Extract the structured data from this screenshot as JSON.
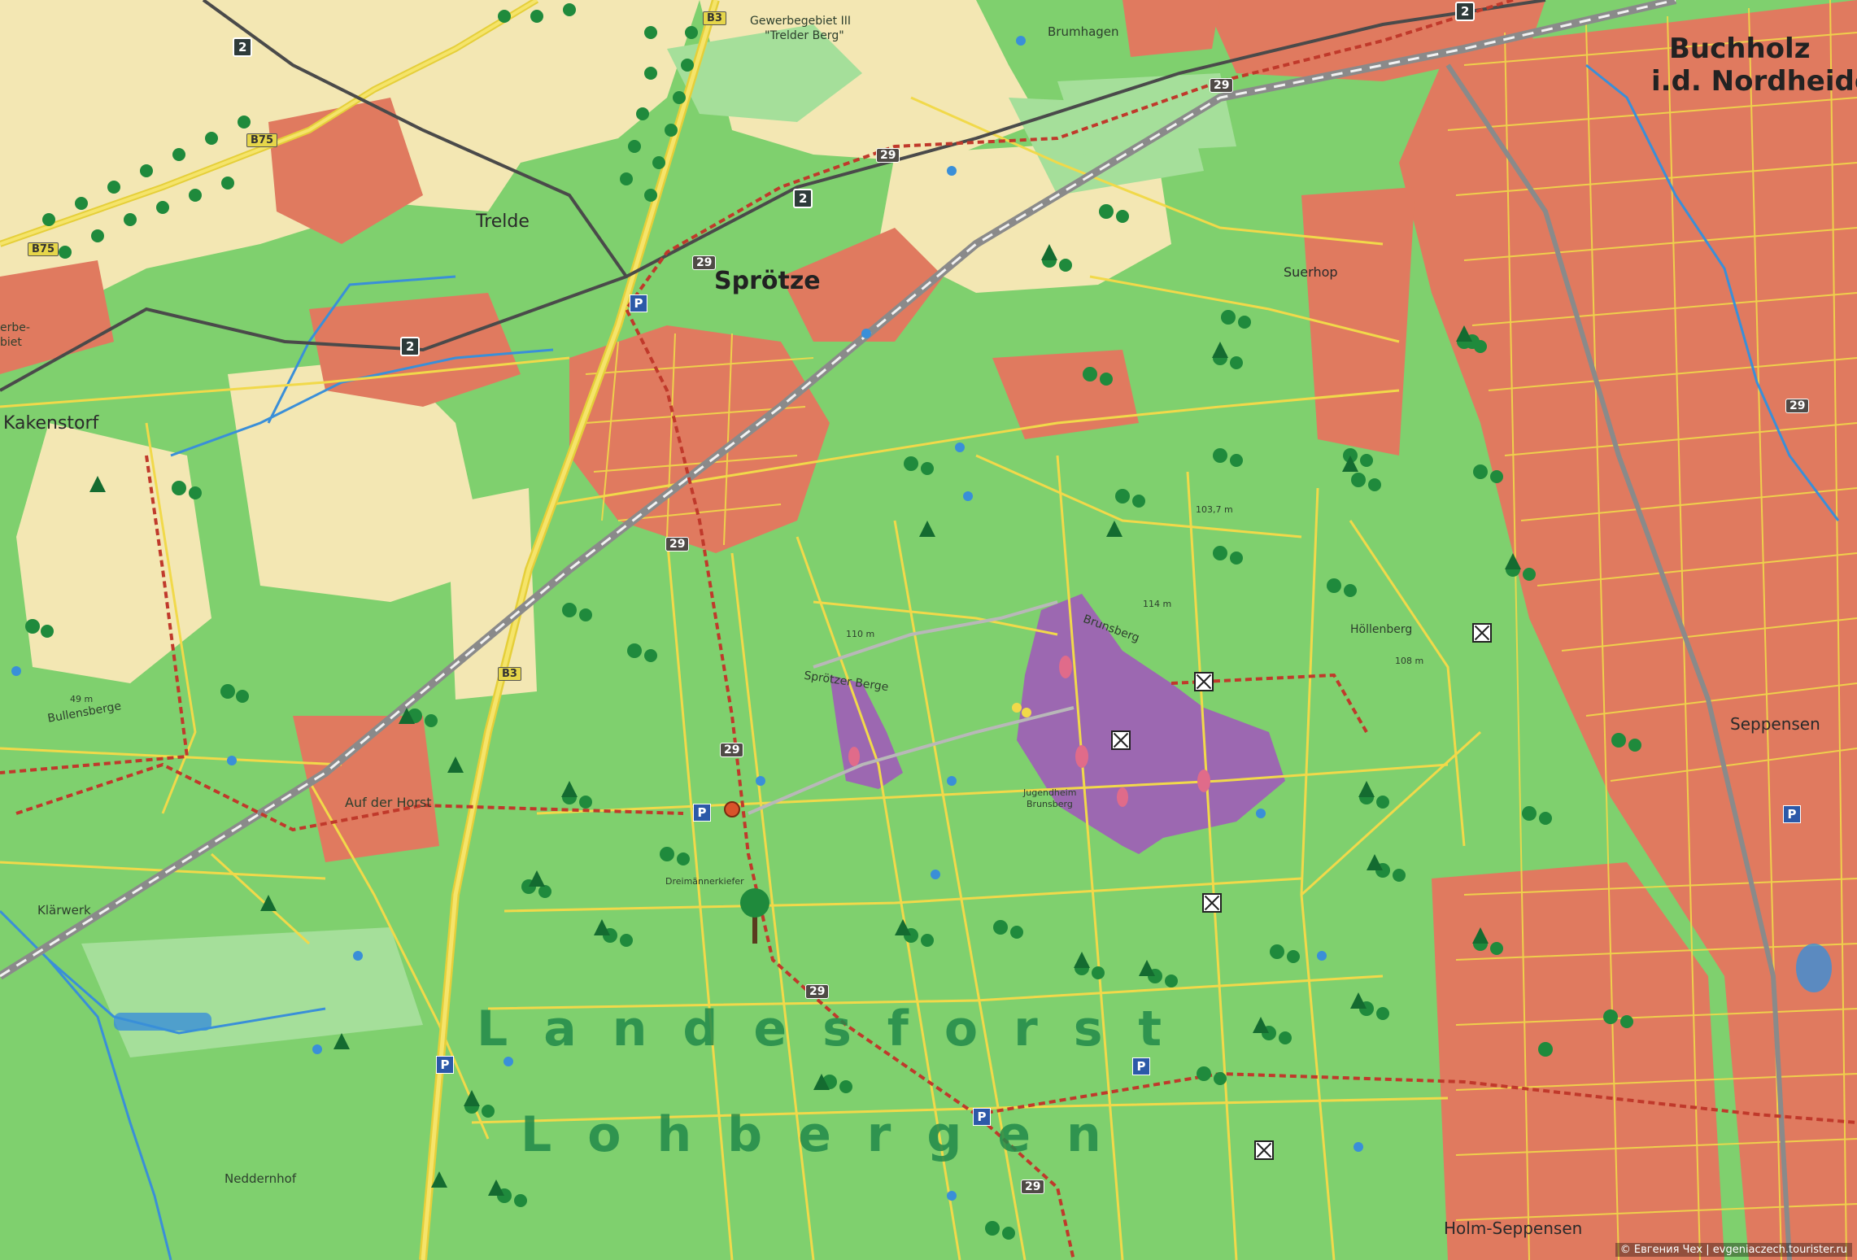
{
  "map": {
    "towns": {
      "buchholz_line1": "Buchholz",
      "buchholz_line2": "i.d. Nordheide",
      "sprotze": "Sprötze",
      "trelde": "Trelde",
      "kakenstorf": "Kakenstorf",
      "suerhop": "Suerhop",
      "seppensen": "Seppensen",
      "holm_seppensen": "Holm-Seppensen",
      "brumhagen": "Brumhagen",
      "auf_der_horst": "Auf der Horst",
      "klarwerk": "Klärwerk",
      "neddernhof": "Neddernhof",
      "bullensberge": "Bullensberge",
      "hollenberg": "Höllenberg",
      "brunsberg": "Brunsberg",
      "sprotzer_berge": "Sprötzer Berge",
      "jugendheim_line1": "Jugendheim",
      "jugendheim_line2": "Brunsberg",
      "dreimannerkiefer": "Dreimännerkiefer",
      "gewerbe_line1": "Gewerbegebiet III",
      "gewerbe_line2": "\"Trelder Berg\"",
      "erbe_line1": "erbe-",
      "erbe_line2": "biet"
    },
    "heights": {
      "h1": "103,7 m",
      "h2": "114 m",
      "h3": "110 m",
      "h4": "108 m",
      "h5": "49 m"
    },
    "forest_name_line1": "Landesforst",
    "forest_name_line2": "Lohbergen",
    "road_shields": {
      "r2": "2",
      "r29": "29",
      "b3": "B3",
      "b75": "B75"
    },
    "parking": "P",
    "credit": "© Евгения Чех | evgeniaczech.tourister.ru",
    "colors": {
      "forest": "#7fd06e",
      "settlement": "#e07a5f",
      "field": "#f3e7b3",
      "heath": "#a05cb8",
      "road": "#f1d94a",
      "water": "#3a8fd8",
      "railway": "#8a8a8a",
      "trail": "#c0392b"
    }
  }
}
